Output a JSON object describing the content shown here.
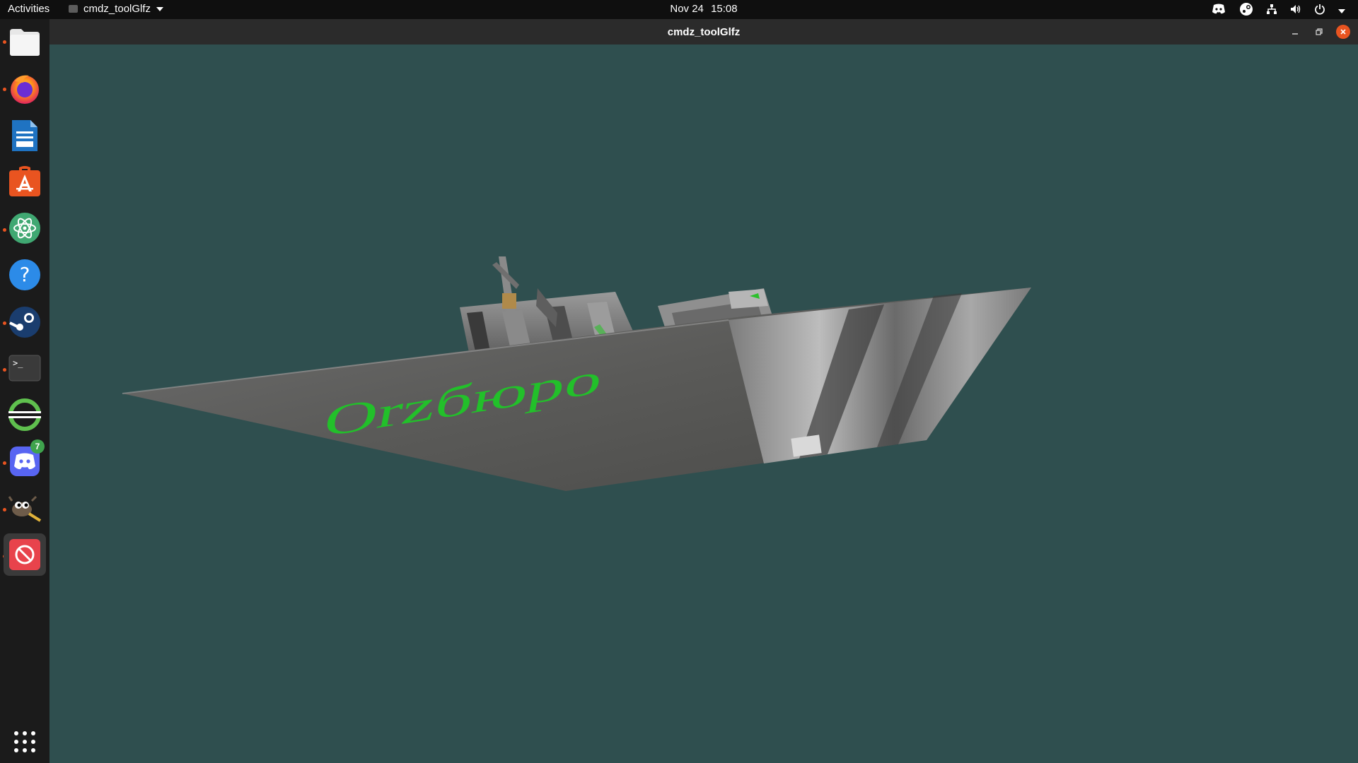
{
  "topbar": {
    "activities": "Activities",
    "app_menu_label": "cmdz_toolGlfz",
    "date": "Nov 24",
    "time": "15:08",
    "tray_icons": [
      "discord-tray-icon",
      "steam-tray-icon",
      "network-icon",
      "volume-icon",
      "power-icon",
      "system-menu-caret-icon"
    ]
  },
  "dock": {
    "items": [
      {
        "name": "files",
        "icon": "files-icon",
        "running": true
      },
      {
        "name": "firefox",
        "icon": "firefox-icon",
        "running": true
      },
      {
        "name": "libreoffice-writer",
        "icon": "writer-icon",
        "running": false
      },
      {
        "name": "ubuntu-software",
        "icon": "software-center-icon",
        "running": false
      },
      {
        "name": "atom",
        "icon": "atom-icon",
        "running": true
      },
      {
        "name": "help",
        "icon": "help-icon",
        "running": false
      },
      {
        "name": "steam",
        "icon": "steam-icon",
        "running": true
      },
      {
        "name": "terminal",
        "icon": "terminal-icon",
        "running": true
      },
      {
        "name": "app-circle",
        "icon": "circle-app-icon",
        "running": false
      },
      {
        "name": "discord",
        "icon": "discord-icon",
        "running": true,
        "badge": "7"
      },
      {
        "name": "gimp",
        "icon": "gimp-icon",
        "running": true
      },
      {
        "name": "cmdz-toolglfz",
        "icon": "blocked-app-icon",
        "running": true,
        "active": true
      }
    ],
    "show_apps_icon": "app-grid-icon"
  },
  "window": {
    "title": "cmdz_toolGlfz",
    "background_color": "#2f4f4f",
    "controls": [
      "minimize",
      "maximize",
      "close"
    ],
    "scene_text": "Orzбюро"
  },
  "colors": {
    "accent": "#e95420",
    "topbar": "#0f0f0f",
    "dock": "#1b1b1b",
    "viewport": "#2f4f4f",
    "scene_text": "#22c02a"
  }
}
